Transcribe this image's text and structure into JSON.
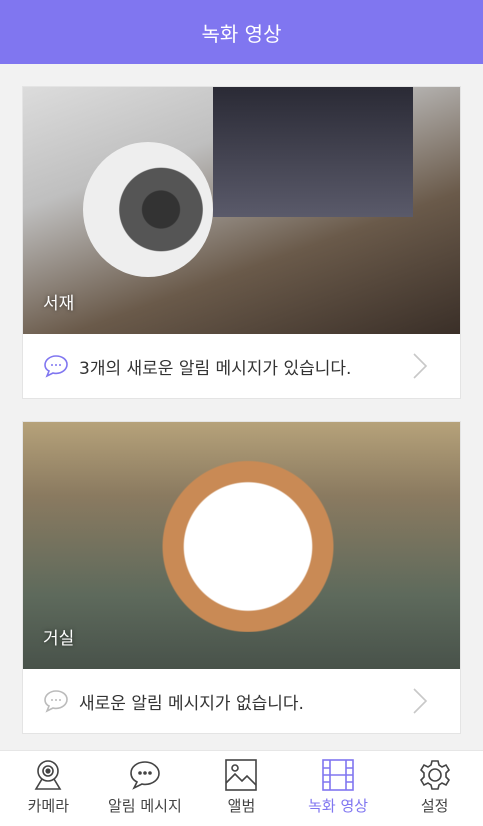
{
  "header": {
    "title": "녹화 영상"
  },
  "cards": [
    {
      "room": "서재",
      "message": "3개의 새로운 알림 메시지가 있습니다.",
      "icon_color": "#8076f0"
    },
    {
      "room": "거실",
      "message": "새로운 알림 메시지가 없습니다.",
      "icon_color": "#bbbbbb"
    }
  ],
  "nav": {
    "items": [
      {
        "label": "카메라",
        "icon": "webcam-icon"
      },
      {
        "label": "알림 메시지",
        "icon": "chat-icon"
      },
      {
        "label": "앨범",
        "icon": "image-icon"
      },
      {
        "label": "녹화 영상",
        "icon": "film-icon",
        "active": true
      },
      {
        "label": "설정",
        "icon": "gear-icon"
      }
    ]
  },
  "colors": {
    "accent": "#8076f0"
  }
}
